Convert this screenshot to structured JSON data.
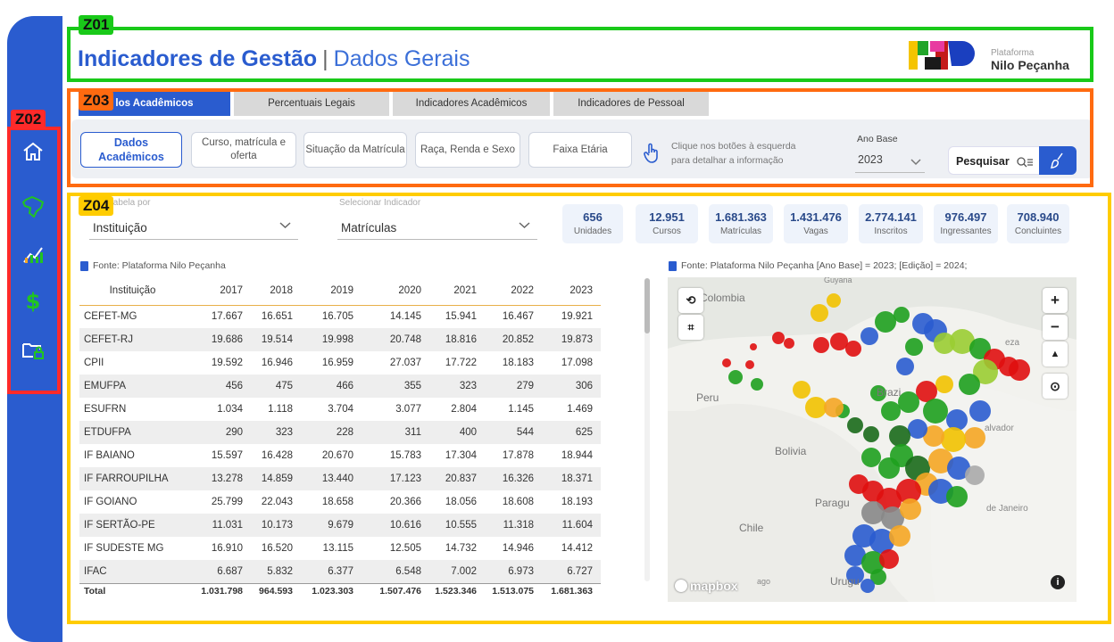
{
  "zones": [
    "Z01",
    "Z02",
    "Z03",
    "Z04"
  ],
  "header": {
    "title": "Indicadores de Gestão",
    "separator": "|",
    "subtitle": "Dados Gerais",
    "logo_small": "Plataforma",
    "logo_big": "Nilo Peçanha"
  },
  "sidebar": {
    "icons": [
      "home-icon",
      "brazil-map-icon",
      "chart-icon",
      "dollar-icon",
      "folder-lock-icon"
    ]
  },
  "tabs": [
    {
      "label": "Dados Acadêmicos",
      "visible_label": "los Acadêmicos",
      "active": true
    },
    {
      "label": "Percentuais Legais",
      "active": false
    },
    {
      "label": "Indicadores Acadêmicos",
      "active": false
    },
    {
      "label": "Indicadores de Pessoal",
      "active": false
    }
  ],
  "subtabs": [
    {
      "label": "Dados\nAcadêmicos",
      "active": true
    },
    {
      "label": "Curso, matrícula e oferta",
      "active": false
    },
    {
      "label": "Situação da Matrícula",
      "active": false
    },
    {
      "label": "Raça, Renda e Sexo",
      "active": false
    },
    {
      "label": "Faixa Etária",
      "active": false
    }
  ],
  "hint": "Clique nos botões à esquerda para detalhar a informação",
  "ano_base": {
    "label": "Ano Base",
    "value": "2023"
  },
  "search": {
    "label": "Pesquisar"
  },
  "filters": {
    "table_by": {
      "label": "tabela por",
      "value": "Instituição"
    },
    "indicator": {
      "label": "Selecionar Indicador",
      "value": "Matrículas"
    }
  },
  "kpis": [
    {
      "value": "656",
      "label": "Unidades"
    },
    {
      "value": "12.951",
      "label": "Cursos"
    },
    {
      "value": "1.681.363",
      "label": "Matrículas"
    },
    {
      "value": "1.431.476",
      "label": "Vagas"
    },
    {
      "value": "2.774.141",
      "label": "Inscritos"
    },
    {
      "value": "976.497",
      "label": "Ingressantes"
    },
    {
      "value": "708.940",
      "label": "Concluintes"
    }
  ],
  "table": {
    "source": "Fonte: Plataforma Nilo Peçanha",
    "columns": [
      "Instituição",
      "2017",
      "2018",
      "2019",
      "2020",
      "2021",
      "2022",
      "2023"
    ],
    "rows": [
      [
        "CEFET-MG",
        "17.667",
        "16.651",
        "16.705",
        "14.145",
        "15.941",
        "16.467",
        "19.921"
      ],
      [
        "CEFET-RJ",
        "19.686",
        "19.514",
        "19.998",
        "20.748",
        "18.816",
        "20.852",
        "19.873"
      ],
      [
        "CPII",
        "19.592",
        "16.946",
        "16.959",
        "27.037",
        "17.722",
        "18.183",
        "17.098"
      ],
      [
        "EMUFPA",
        "456",
        "475",
        "466",
        "355",
        "323",
        "279",
        "306"
      ],
      [
        "ESUFRN",
        "1.034",
        "1.118",
        "3.704",
        "3.077",
        "2.804",
        "1.145",
        "1.469"
      ],
      [
        "ETDUFPA",
        "290",
        "323",
        "228",
        "311",
        "400",
        "544",
        "625"
      ],
      [
        "IF BAIANO",
        "15.597",
        "16.428",
        "20.670",
        "15.783",
        "17.304",
        "17.878",
        "18.944"
      ],
      [
        "IF FARROUPILHA",
        "13.278",
        "14.859",
        "13.440",
        "17.123",
        "20.837",
        "16.326",
        "18.371"
      ],
      [
        "IF GOIANO",
        "25.799",
        "22.043",
        "18.658",
        "20.366",
        "18.056",
        "18.608",
        "18.193"
      ],
      [
        "IF SERTÃO-PE",
        "11.031",
        "10.173",
        "9.679",
        "10.616",
        "10.555",
        "11.318",
        "11.604"
      ],
      [
        "IF SUDESTE MG",
        "16.910",
        "16.520",
        "13.115",
        "12.505",
        "14.732",
        "14.946",
        "14.412"
      ],
      [
        "IFAC",
        "6.687",
        "5.832",
        "6.377",
        "6.548",
        "7.002",
        "6.973",
        "6.727"
      ]
    ],
    "total": [
      "Total",
      "1.031.798",
      "964.593",
      "1.023.303",
      "1.507.476",
      "1.523.346",
      "1.513.075",
      "1.681.363"
    ]
  },
  "map": {
    "source": "Fonte: Plataforma Nilo Peçanha [Ano Base] = 2023; [Edição] = 2024;",
    "labels": {
      "colombia": "Colombia",
      "peru": "Peru",
      "brazil": "Brazi",
      "bolivia": "Bolivia",
      "paraguay": "Paragu",
      "chile": "Chile",
      "uruguay": "Urugu",
      "guyana": "Guyana",
      "rio": "de Janeiro",
      "salvador": "alvador",
      "fortaleza": "eza",
      "santiago": "ago"
    },
    "attribution": "mapbox"
  }
}
